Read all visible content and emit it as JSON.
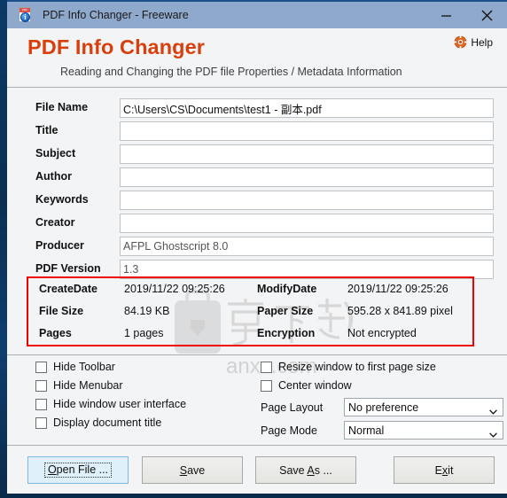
{
  "window": {
    "title": "PDF Info Changer - Freeware",
    "app_icon": "pdf-info-icon",
    "controls": [
      {
        "name": "minimize-button",
        "glyph": "minimize"
      },
      {
        "name": "close-button",
        "glyph": "close"
      }
    ]
  },
  "header": {
    "brand_title": "PDF Info Changer",
    "subtitle": "Reading and Changing the PDF file Properties / Metadata Information",
    "help_label": "Help",
    "help_icon": "lifebuoy-icon",
    "brand_color": "#d93f0b"
  },
  "watermark": {
    "text_cn": "安下载",
    "text_url": "anxz.com",
    "icon": "briefcase-shield-icon"
  },
  "form": {
    "fields": [
      {
        "label": "File Name",
        "value": "C:\\Users\\CS\\Documents\\test1 - 副本.pdf",
        "name": "file-name"
      },
      {
        "label": "Title",
        "value": "",
        "name": "title"
      },
      {
        "label": "Subject",
        "value": "",
        "name": "subject"
      },
      {
        "label": "Author",
        "value": "",
        "name": "author"
      },
      {
        "label": "Keywords",
        "value": "",
        "name": "keywords"
      },
      {
        "label": "Creator",
        "value": "",
        "name": "creator"
      },
      {
        "label": "Producer",
        "value": "AFPL Ghostscript 8.0",
        "name": "producer"
      },
      {
        "label": "PDF Version",
        "value": "1.3",
        "name": "pdf-version"
      }
    ]
  },
  "info": {
    "border_color": "#ee0000",
    "rows": [
      {
        "label1": "CreateDate",
        "value1": "2019/11/22 09:25:26",
        "label2": "ModifyDate",
        "value2": "2019/11/22 09:25:26"
      },
      {
        "label1": "File Size",
        "value1": "84.19 KB",
        "label2": "Paper Size",
        "value2": "595.28 x 841.89 pixel"
      },
      {
        "label1": "Pages",
        "value1": "1 pages",
        "label2": "Encryption",
        "value2": "Not encrypted"
      }
    ]
  },
  "options": {
    "left_checkboxes": [
      {
        "label": "Hide Toolbar",
        "checked": false,
        "name": "hide-toolbar"
      },
      {
        "label": "Hide Menubar",
        "checked": false,
        "name": "hide-menubar"
      },
      {
        "label": "Hide window user interface",
        "checked": false,
        "name": "hide-window-user-interface"
      },
      {
        "label": "Display document title",
        "checked": false,
        "name": "display-document-title"
      }
    ],
    "right_checkboxes": [
      {
        "label": "Resize window to first page size",
        "checked": false,
        "name": "resize-window-to-first-page-size"
      },
      {
        "label": "Center window",
        "checked": false,
        "name": "center-window"
      }
    ],
    "selects": [
      {
        "label": "Page Layout",
        "value": "No preference",
        "name": "page-layout"
      },
      {
        "label": "Page Mode",
        "value": "Normal",
        "name": "page-mode"
      }
    ]
  },
  "buttons": [
    {
      "name": "open-file-button",
      "pre": "",
      "accel": "O",
      "post": "pen File ...",
      "focused": true
    },
    {
      "name": "save-button",
      "pre": "",
      "accel": "S",
      "post": "ave",
      "focused": false
    },
    {
      "name": "save-as-button",
      "pre": "Save ",
      "accel": "A",
      "post": "s ...",
      "focused": false
    },
    {
      "name": "exit-button",
      "pre": "E",
      "accel": "x",
      "post": "it",
      "focused": false
    }
  ]
}
